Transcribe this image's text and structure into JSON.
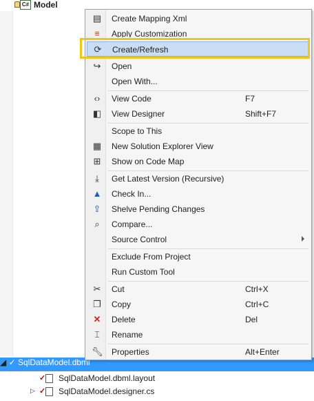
{
  "tree": {
    "root_label": "Model",
    "root_badge": "C#",
    "selected_item": "SqlDataModel.dbml",
    "children": [
      "SqlDataModel.dbml.layout",
      "SqlDataModel.designer.cs"
    ]
  },
  "menu": {
    "items": [
      {
        "label": "Create Mapping Xml",
        "shortcut": ""
      },
      {
        "label": "Apply Customization",
        "shortcut": ""
      },
      {
        "label": "Create/Refresh",
        "shortcut": ""
      },
      {
        "label": "Open",
        "shortcut": ""
      },
      {
        "label": "Open With...",
        "shortcut": ""
      },
      {
        "label": "View Code",
        "shortcut": "F7"
      },
      {
        "label": "View Designer",
        "shortcut": "Shift+F7"
      },
      {
        "label": "Scope to This",
        "shortcut": ""
      },
      {
        "label": "New Solution Explorer View",
        "shortcut": ""
      },
      {
        "label": "Show on Code Map",
        "shortcut": ""
      },
      {
        "label": "Get Latest Version (Recursive)",
        "shortcut": ""
      },
      {
        "label": "Check In...",
        "shortcut": ""
      },
      {
        "label": "Shelve Pending Changes",
        "shortcut": ""
      },
      {
        "label": "Compare...",
        "shortcut": ""
      },
      {
        "label": "Source Control",
        "shortcut": ""
      },
      {
        "label": "Exclude From Project",
        "shortcut": ""
      },
      {
        "label": "Run Custom Tool",
        "shortcut": ""
      },
      {
        "label": "Cut",
        "shortcut": "Ctrl+X"
      },
      {
        "label": "Copy",
        "shortcut": "Ctrl+C"
      },
      {
        "label": "Delete",
        "shortcut": "Del"
      },
      {
        "label": "Rename",
        "shortcut": ""
      },
      {
        "label": "Properties",
        "shortcut": "Alt+Enter"
      }
    ]
  },
  "colors": {
    "highlight_box": "#f2c618",
    "selection": "#3399ff",
    "menu_hover": "#c9def5",
    "delete_icon": "#d9241c"
  }
}
